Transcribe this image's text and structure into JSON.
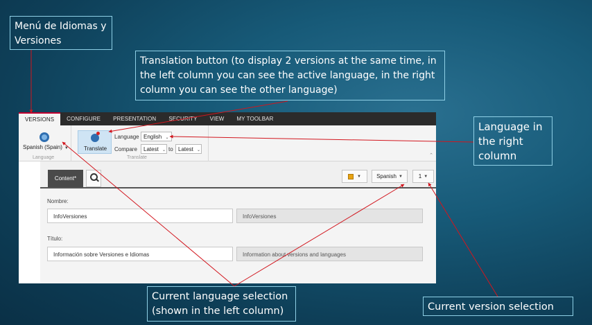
{
  "callouts": {
    "menu": "Menú de Idiomas y Versiones",
    "translate": "Translation button (to display 2 versions at the same time, in the left column you can see the active language, in the right column you can see the other language)",
    "language_right": "Language in the right column",
    "current_language": "Current language selection (shown in the left column)",
    "current_version": "Current version selection"
  },
  "ribbon_tabs": [
    "VERSIONS",
    "CONFIGURE",
    "PRESENTATION",
    "SECURITY",
    "VIEW",
    "MY TOOLBAR"
  ],
  "language_group": {
    "selected": "Spanish (Spain)",
    "group_name": "Language"
  },
  "translate_group": {
    "button_label": "Translate",
    "language_label": "Language",
    "language_value": "English",
    "compare_label": "Compare",
    "compare_from": "Latest",
    "to_label": "to",
    "compare_to": "Latest",
    "group_name": "Translate"
  },
  "editor_toolbar": {
    "content_tab": "Content*",
    "language_button": "Spanish",
    "version_button": "1"
  },
  "fields": {
    "nombre_label": "Nombre:",
    "nombre_left": "InfoVersiones",
    "nombre_right": "InfoVersiones",
    "titulo_label": "Título:",
    "titulo_left": "Información sobre Versiones e Idiomas",
    "titulo_right": "Information about versions and languages"
  },
  "colors": {
    "arrow": "#d2161e",
    "callout_border": "#8fd0e6",
    "active_tab_accent": "#c2002f"
  }
}
